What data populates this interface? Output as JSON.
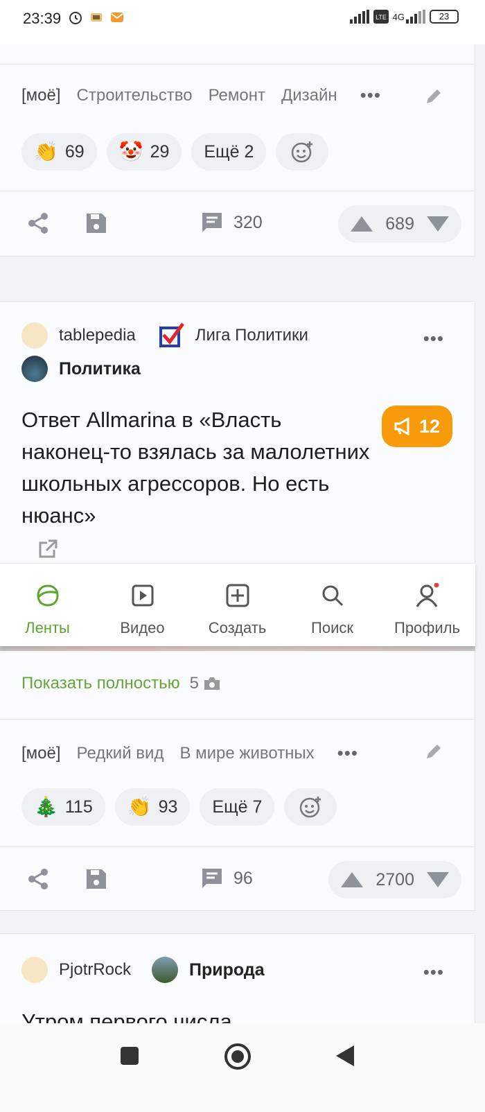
{
  "status": {
    "time": "23:39",
    "network": "4G",
    "battery": "23"
  },
  "post1": {
    "tags": [
      "[моё]",
      "Строительство",
      "Ремонт",
      "Дизайн"
    ],
    "reactions": [
      {
        "emoji": "👏",
        "icon": "clap-emoji",
        "count": "69"
      },
      {
        "emoji": "🤡",
        "icon": "clown-emoji",
        "count": "29"
      }
    ],
    "more_reactions": "Ещё 2",
    "comments": "320",
    "rating": "689"
  },
  "post2": {
    "author": "tablepedia",
    "community": "Лига Политики",
    "subcommunity": "Политика",
    "title": "Ответ Allmarina в «Власть наконец-то взялась за малолетних школьных агрессоров. Но есть нюанс»",
    "badge_count": "12",
    "show_full": "Показать полностью",
    "photo_count": "5",
    "tags": [
      "[моё]",
      "Редкий вид",
      "В мире животных"
    ],
    "reactions": [
      {
        "emoji": "🎄",
        "icon": "christmas-tree-emoji",
        "count": "115"
      },
      {
        "emoji": "👏",
        "icon": "clap-emoji",
        "count": "93"
      }
    ],
    "more_reactions": "Ещё 7",
    "comments": "96",
    "rating": "2700"
  },
  "post3": {
    "author": "PjotrRock",
    "community": "Природа",
    "title": "Утром первого числа"
  },
  "tabbar": {
    "tabs": [
      {
        "label": "Ленты",
        "icon": "feeds-icon",
        "active": true
      },
      {
        "label": "Видео",
        "icon": "video-icon"
      },
      {
        "label": "Создать",
        "icon": "create-icon"
      },
      {
        "label": "Поиск",
        "icon": "search-icon"
      },
      {
        "label": "Профиль",
        "icon": "profile-icon"
      }
    ]
  },
  "colors": {
    "accent": "#67a53b",
    "badge": "#f79b0a",
    "notification": "#e0453a"
  }
}
